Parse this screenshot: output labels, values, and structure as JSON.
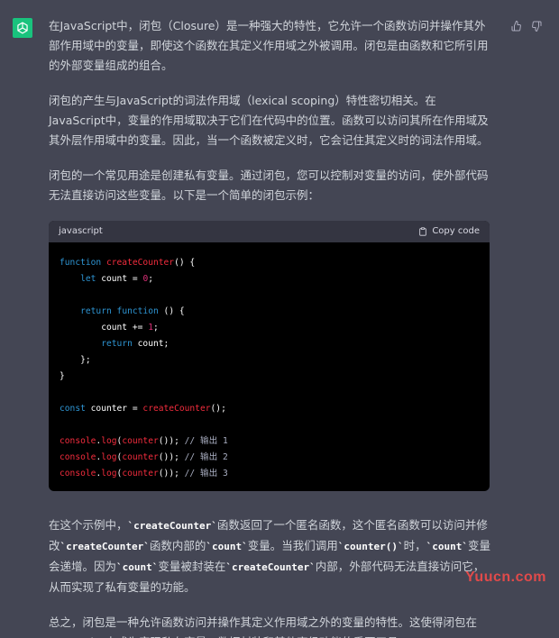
{
  "message": {
    "paragraph1": "在JavaScript中，闭包（Closure）是一种强大的特性，它允许一个函数访问并操作其外部作用域中的变量，即使这个函数在其定义作用域之外被调用。闭包是由函数和它所引用的外部变量组成的组合。",
    "paragraph2": "闭包的产生与JavaScript的词法作用域（lexical scoping）特性密切相关。在JavaScript中，变量的作用域取决于它们在代码中的位置。函数可以访问其所在作用域及其外层作用域中的变量。因此，当一个函数被定义时，它会记住其定义时的词法作用域。",
    "paragraph3": "闭包的一个常见用途是创建私有变量。通过闭包，您可以控制对变量的访问，使外部代码无法直接访问这些变量。以下是一个简单的闭包示例：",
    "paragraph4_parts": [
      {
        "text": "在这个示例中，",
        "code": false
      },
      {
        "text": "`createCounter`",
        "code": true
      },
      {
        "text": "函数返回了一个匿名函数，这个匿名函数可以访问并修改",
        "code": false
      },
      {
        "text": "`createCounter`",
        "code": true
      },
      {
        "text": "函数内部的",
        "code": false
      },
      {
        "text": "`count`",
        "code": true
      },
      {
        "text": "变量。当我们调用",
        "code": false
      },
      {
        "text": "`counter()`",
        "code": true
      },
      {
        "text": "时，",
        "code": false
      },
      {
        "text": "`count`",
        "code": true
      },
      {
        "text": "变量会递增。因为",
        "code": false
      },
      {
        "text": "`count`",
        "code": true
      },
      {
        "text": "变量被封装在",
        "code": false
      },
      {
        "text": "`createCounter`",
        "code": true
      },
      {
        "text": "内部，外部代码无法直接访问它，从而实现了私有变量的功能。",
        "code": false
      }
    ],
    "paragraph5": "总之，闭包是一种允许函数访问并操作其定义作用域之外的变量的特性。这使得闭包在JavaScript中成为实现私有变量、数据封装和其他高级功能的重要工具。"
  },
  "code_block": {
    "language": "javascript",
    "copy_label": "Copy code",
    "lines": [
      [
        {
          "t": "function ",
          "c": "kw"
        },
        {
          "t": "createCounter",
          "c": "fn"
        },
        {
          "t": "() {",
          "c": "plain"
        }
      ],
      [
        {
          "t": "    ",
          "c": "plain"
        },
        {
          "t": "let ",
          "c": "kw"
        },
        {
          "t": "count = ",
          "c": "plain"
        },
        {
          "t": "0",
          "c": "num"
        },
        {
          "t": ";",
          "c": "plain"
        }
      ],
      [
        {
          "t": "",
          "c": "plain"
        }
      ],
      [
        {
          "t": "    ",
          "c": "plain"
        },
        {
          "t": "return ",
          "c": "kw"
        },
        {
          "t": "function",
          "c": "kw"
        },
        {
          "t": " () {",
          "c": "plain"
        }
      ],
      [
        {
          "t": "        count += ",
          "c": "plain"
        },
        {
          "t": "1",
          "c": "num"
        },
        {
          "t": ";",
          "c": "plain"
        }
      ],
      [
        {
          "t": "        ",
          "c": "plain"
        },
        {
          "t": "return ",
          "c": "kw"
        },
        {
          "t": "count;",
          "c": "plain"
        }
      ],
      [
        {
          "t": "    };",
          "c": "plain"
        }
      ],
      [
        {
          "t": "}",
          "c": "plain"
        }
      ],
      [
        {
          "t": "",
          "c": "plain"
        }
      ],
      [
        {
          "t": "const ",
          "c": "kw"
        },
        {
          "t": "counter = ",
          "c": "plain"
        },
        {
          "t": "createCounter",
          "c": "fn"
        },
        {
          "t": "();",
          "c": "plain"
        }
      ],
      [
        {
          "t": "",
          "c": "plain"
        }
      ],
      [
        {
          "t": "console",
          "c": "fn"
        },
        {
          "t": ".",
          "c": "plain"
        },
        {
          "t": "log",
          "c": "fn"
        },
        {
          "t": "(",
          "c": "plain"
        },
        {
          "t": "counter",
          "c": "fn"
        },
        {
          "t": "()); ",
          "c": "plain"
        },
        {
          "t": "// 输出 1",
          "c": "cm"
        }
      ],
      [
        {
          "t": "console",
          "c": "fn"
        },
        {
          "t": ".",
          "c": "plain"
        },
        {
          "t": "log",
          "c": "fn"
        },
        {
          "t": "(",
          "c": "plain"
        },
        {
          "t": "counter",
          "c": "fn"
        },
        {
          "t": "()); ",
          "c": "plain"
        },
        {
          "t": "// 输出 2",
          "c": "cm"
        }
      ],
      [
        {
          "t": "console",
          "c": "fn"
        },
        {
          "t": ".",
          "c": "plain"
        },
        {
          "t": "log",
          "c": "fn"
        },
        {
          "t": "(",
          "c": "plain"
        },
        {
          "t": "counter",
          "c": "fn"
        },
        {
          "t": "()); ",
          "c": "plain"
        },
        {
          "t": "// 输出 3",
          "c": "cm"
        }
      ]
    ]
  },
  "icons": {
    "avatar": "openai-logo-icon",
    "thumbs_up": "thumbs-up-icon",
    "thumbs_down": "thumbs-down-icon",
    "copy": "clipboard-icon"
  },
  "colors": {
    "background": "#444654",
    "avatar_bg": "#19c37d",
    "code_bg": "#000000",
    "code_header_bg": "#343541",
    "text": "#d1d5db"
  },
  "watermark": "Yuucn.com"
}
